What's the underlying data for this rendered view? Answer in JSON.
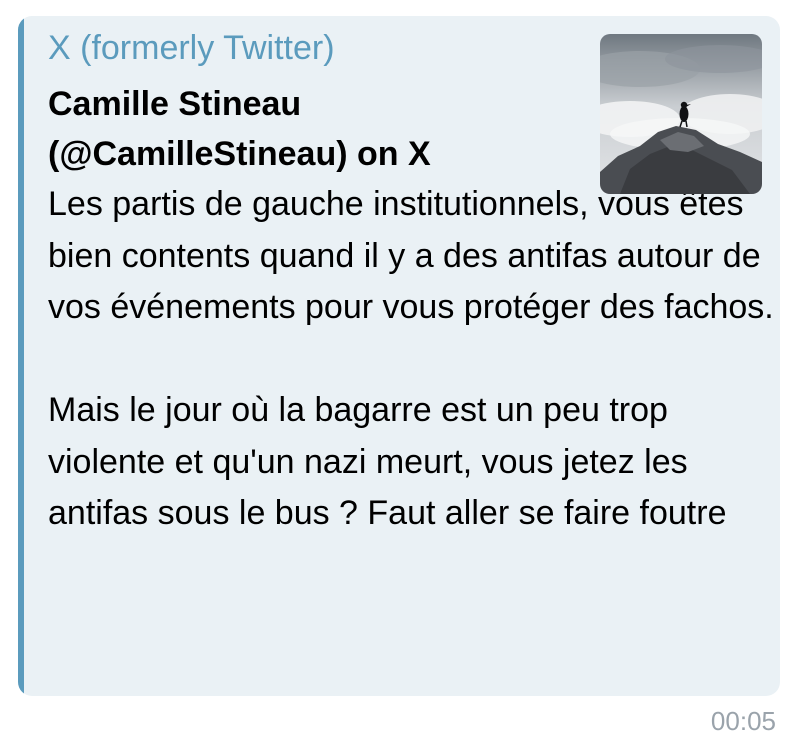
{
  "link_preview": {
    "site_name": "X (formerly Twitter)",
    "title": "Camille Stineau (@CamilleStineau) on X",
    "text": "Les partis de gauche institutionnels, vous êtes bien contents quand il y a des antifas autour de vos événements pour vous protéger des fachos.\n\nMais le jour où la bagarre est un peu trop violente et qu'un nazi meurt, vous jetez les antifas sous le bus ? Faut aller se faire foutre",
    "thumbnail_icon": "bird-on-rock-photo"
  },
  "message": {
    "time": "00:05"
  },
  "colors": {
    "accent": "#5b9bbd",
    "card_background": "#eaf1f5",
    "timestamp": "#9aa3ab"
  }
}
